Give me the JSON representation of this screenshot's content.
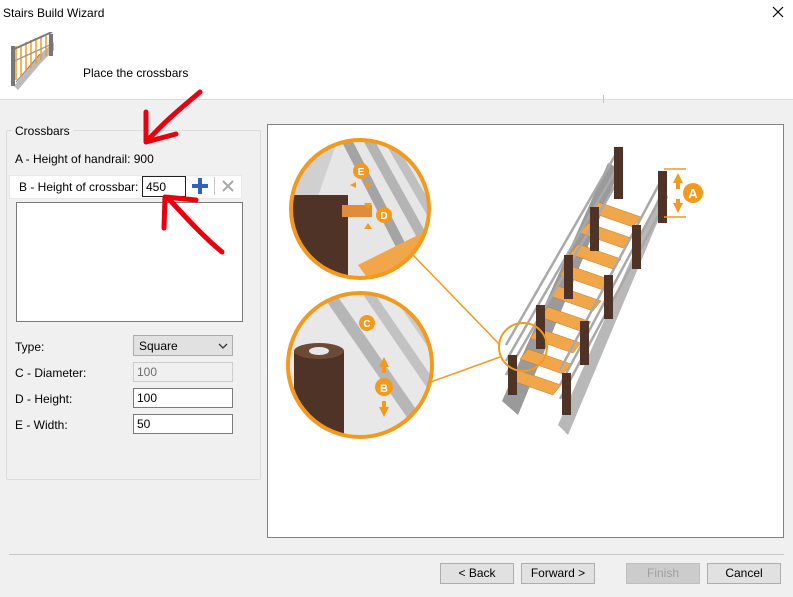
{
  "window": {
    "title": "Stairs Build Wizard"
  },
  "header": {
    "step_title": "Place the crossbars",
    "icon": "stairs-wizard-icon"
  },
  "crossbars": {
    "group_label": "Crossbars",
    "handrail_height_text": "A - Height of handrail: 900",
    "crossbar_height_label": "B - Height of crossbar:",
    "crossbar_height_value": "450",
    "add_icon": "plus-icon",
    "delete_icon": "cross-icon",
    "list_items": []
  },
  "params": {
    "type_label": "Type:",
    "type_value": "Square",
    "diameter_label": "C - Diameter:",
    "diameter_value": "100",
    "height_label": "D - Height:",
    "height_value": "100",
    "width_label": "E - Width:",
    "width_value": "50"
  },
  "preview": {
    "markers": {
      "a": "A",
      "b": "B",
      "c": "C",
      "d": "D",
      "e": "E"
    },
    "accent_color": "#f39a1e",
    "wood_color": "#f2a64a",
    "post_color": "#4e3326",
    "rail_color": "#a9a9a9"
  },
  "annotation": {
    "color": "#e8000f"
  },
  "footer": {
    "back_label": "< Back",
    "forward_label": "Forward >",
    "finish_label": "Finish",
    "cancel_label": "Cancel"
  }
}
